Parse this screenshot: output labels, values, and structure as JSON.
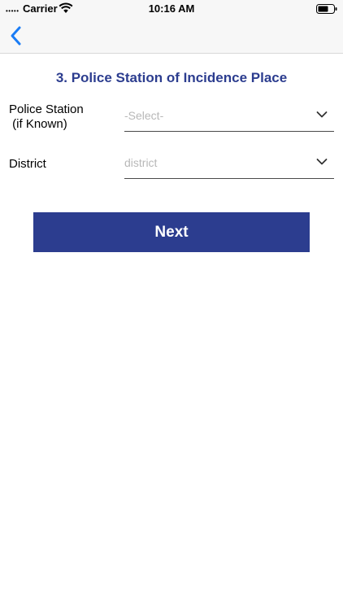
{
  "status_bar": {
    "signal": "•••••",
    "carrier": "Carrier",
    "wifi_icon": "wifi-icon",
    "time": "10:16 AM",
    "battery_icon": "battery-icon"
  },
  "nav": {
    "back_icon": "chevron-left-icon",
    "accent_color": "#1a7cf5"
  },
  "form": {
    "title": "3. Police Station of Incidence Place",
    "title_color": "#2c3d8f",
    "fields": [
      {
        "label_line1": "Police Station",
        "label_line2": " (if Known)",
        "placeholder": "-Select-",
        "icon": "chevron-down-icon"
      },
      {
        "label_line1": "District",
        "placeholder": "district",
        "icon": "chevron-down-icon"
      }
    ],
    "next_label": "Next",
    "button_color": "#2c3d8f"
  }
}
